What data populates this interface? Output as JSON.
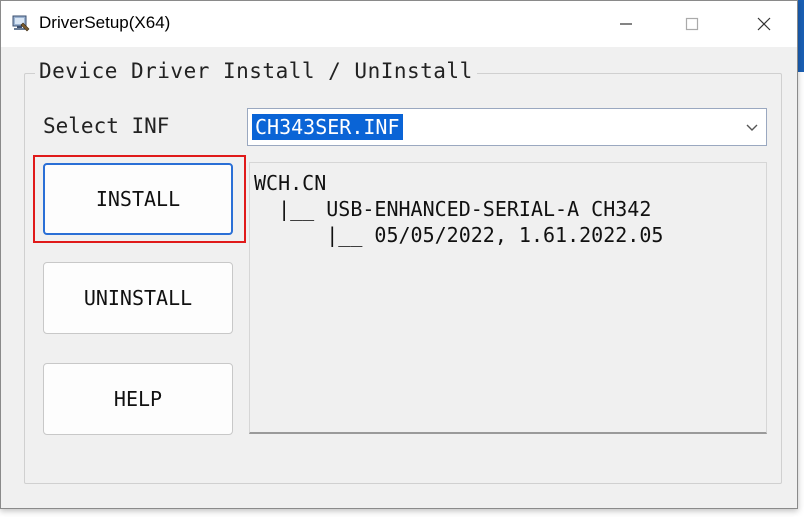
{
  "window": {
    "title": "DriverSetup(X64)"
  },
  "group": {
    "legend": "Device Driver Install / UnInstall"
  },
  "select": {
    "label": "Select INF",
    "value": "CH343SER.INF"
  },
  "buttons": {
    "install": "INSTALL",
    "uninstall": "UNINSTALL",
    "help": "HELP"
  },
  "info": {
    "lines": [
      "WCH.CN",
      "  |__ USB-ENHANCED-SERIAL-A CH342",
      "      |__ 05/05/2022, 1.61.2022.05"
    ]
  },
  "icons": {
    "app": "driver-setup-icon",
    "minimize": "minimize-icon",
    "maximize": "maximize-icon",
    "close": "close-icon",
    "dropdown": "chevron-down-icon"
  },
  "colors": {
    "selection": "#0a64d6",
    "highlight": "#e01a1a",
    "window_bg": "#f0f0f0"
  }
}
